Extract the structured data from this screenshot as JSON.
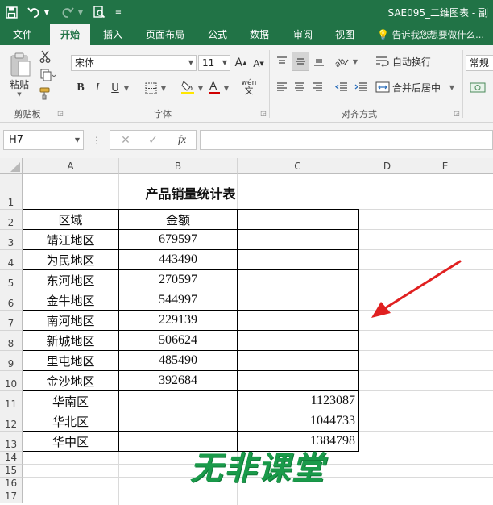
{
  "app": {
    "doc_title": "SAE095_二维图表 - 副",
    "quick_access": [
      "save-icon",
      "undo-icon",
      "redo-icon",
      "print-preview-icon",
      "customize-icon"
    ]
  },
  "tabs": [
    {
      "label": "文件",
      "active": false
    },
    {
      "label": "开始",
      "active": true
    },
    {
      "label": "插入",
      "active": false
    },
    {
      "label": "页面布局",
      "active": false
    },
    {
      "label": "公式",
      "active": false
    },
    {
      "label": "数据",
      "active": false
    },
    {
      "label": "审阅",
      "active": false
    },
    {
      "label": "视图",
      "active": false
    }
  ],
  "tell_me": "告诉我您想要做什么...",
  "ribbon": {
    "clipboard": {
      "paste_label": "粘贴",
      "group_label": "剪贴板"
    },
    "font": {
      "name": "宋体",
      "size": "11",
      "group_label": "字体",
      "bold": "B",
      "italic": "I",
      "underline": "U",
      "phonetic": "wén"
    },
    "alignment": {
      "wrap_text": "自动换行",
      "merge_center": "合并后居中",
      "group_label": "对齐方式"
    },
    "number": {
      "format": "常规"
    },
    "colors": {
      "accent": "#217346",
      "fill_underline": "#ffe600",
      "font_underline": "#d00000",
      "arrow": "#e02020",
      "watermark": "#1a9a4a"
    }
  },
  "formula_bar": {
    "name_box": "H7",
    "cancel": "✕",
    "enter": "✓",
    "fx": "fx",
    "value": ""
  },
  "columns": [
    "A",
    "B",
    "C",
    "D",
    "E"
  ],
  "rows": [
    "1",
    "2",
    "3",
    "4",
    "5",
    "6",
    "7",
    "8",
    "9",
    "10",
    "11",
    "12",
    "13",
    "14",
    "15",
    "16",
    "17"
  ],
  "sheet": {
    "title": "产品销量统计表",
    "headers": {
      "region": "区域",
      "amount": "金额"
    },
    "regions": [
      {
        "name": "靖江地区",
        "amount": "679597"
      },
      {
        "name": "为民地区",
        "amount": "443490"
      },
      {
        "name": "东河地区",
        "amount": "270597"
      },
      {
        "name": "金牛地区",
        "amount": "544997"
      },
      {
        "name": "南河地区",
        "amount": "229139"
      },
      {
        "name": "新城地区",
        "amount": "506624"
      },
      {
        "name": "里屯地区",
        "amount": "485490"
      },
      {
        "name": "金沙地区",
        "amount": "392684"
      }
    ],
    "areas": [
      {
        "name": "华南区",
        "total": "1123087"
      },
      {
        "name": "华北区",
        "total": "1044733"
      },
      {
        "name": "华中区",
        "total": "1384798"
      }
    ]
  },
  "watermark": "无非课堂"
}
